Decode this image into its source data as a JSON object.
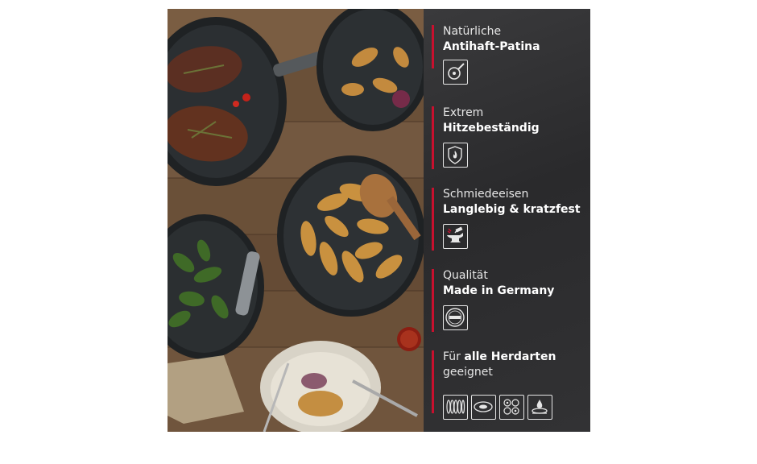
{
  "features": [
    {
      "line1": "Natürliche",
      "line2": "Antihaft-Patina",
      "icon": "nonstick-pan-icon"
    },
    {
      "line1": "Extrem",
      "line2": "Hitzebeständig",
      "icon": "flame-shield-icon"
    },
    {
      "line1": "Schmiedeeisen",
      "line2": "Langlebig & kratzfest",
      "icon": "anvil-hammer-icon"
    },
    {
      "line1": "Qualität",
      "line2": "Made in Germany",
      "icon": "made-in-germany-seal-icon"
    }
  ],
  "hob": {
    "prefix": "Für ",
    "bold": "alle Herdarten",
    "line2": "geeignet",
    "icons": [
      "induction-coil-icon",
      "electric-plate-icon",
      "ceramic-hob-icon",
      "gas-burner-icon"
    ]
  },
  "seal_text": "MADE IN GERMANY",
  "colors": {
    "accent": "#c8102e",
    "panel": "#2e2e30"
  }
}
